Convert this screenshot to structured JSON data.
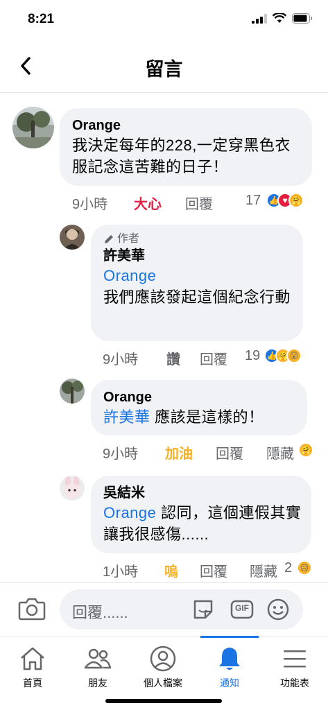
{
  "status": {
    "time": "8:21"
  },
  "header": {
    "title": "留言"
  },
  "comments": [
    {
      "author": "Orange",
      "text": "我決定每年的228,一定穿黑色衣服記念這苦難的日子！",
      "time": "9小時",
      "reaction_label": "大心",
      "reply_label": "回覆",
      "reaction_count": "17"
    },
    {
      "author_tag": "作者",
      "author": "許美華",
      "mention": "Orange",
      "text": "我們應該發起這個紀念行動",
      "time": "9小時",
      "reaction_label": "讚",
      "reply_label": "回覆",
      "reaction_count": "19"
    },
    {
      "author": "Orange",
      "mention": "許美華",
      "text": "應該是這樣的！",
      "time": "9小時",
      "reaction_label": "加油",
      "reply_label": "回覆",
      "hide_label": "隱藏"
    },
    {
      "author": "吳結米",
      "mention": "Orange",
      "text": "認同，這個連假其實讓我很感傷......",
      "time": "1小時",
      "reaction_label": "嗚",
      "reply_label": "回覆",
      "hide_label": "隱藏",
      "reaction_count": "2"
    }
  ],
  "composer": {
    "placeholder": "回覆......",
    "gif_label": "GIF"
  },
  "tabs": [
    {
      "label": "首頁",
      "icon": "home-icon"
    },
    {
      "label": "朋友",
      "icon": "friends-icon"
    },
    {
      "label": "個人檔案",
      "icon": "profile-icon"
    },
    {
      "label": "通知",
      "icon": "bell-icon",
      "active": true
    },
    {
      "label": "功能表",
      "icon": "menu-icon"
    }
  ],
  "colors": {
    "accent": "#1b74e4",
    "heart": "#e41e3f",
    "care": "#f7b125",
    "bubble": "#f0f2f5",
    "secondary_text": "#65676b"
  }
}
